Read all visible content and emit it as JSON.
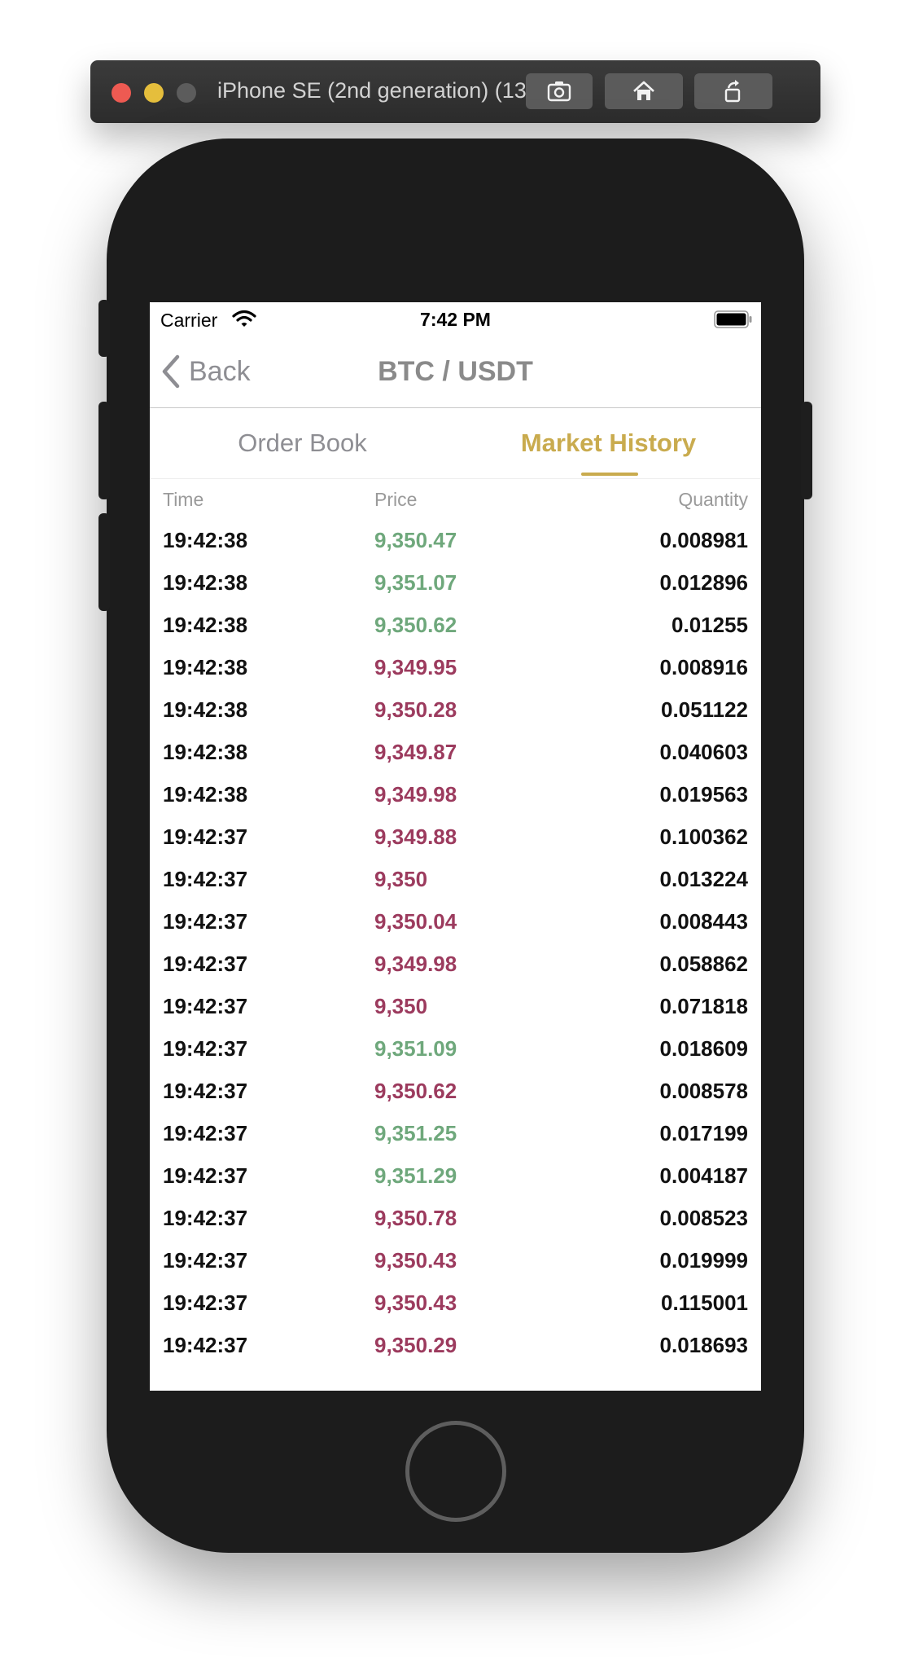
{
  "simulator": {
    "title": "iPhone SE (2nd generation) (13...",
    "buttons": [
      "screenshot",
      "home",
      "rotate"
    ]
  },
  "status_bar": {
    "carrier": "Carrier",
    "time": "7:42 PM"
  },
  "nav": {
    "back_label": "Back",
    "title": "BTC / USDT"
  },
  "tabs": [
    {
      "label": "Order Book",
      "selected": false
    },
    {
      "label": "Market History",
      "selected": true
    }
  ],
  "columns": {
    "time": "Time",
    "price": "Price",
    "quantity": "Quantity"
  },
  "colors": {
    "up": "#6fa87c",
    "down": "#9c3b5e",
    "accent": "#c9ab4e"
  },
  "trades": [
    {
      "time": "19:42:38",
      "price": "9,350.47",
      "side": "up",
      "quantity": "0.008981"
    },
    {
      "time": "19:42:38",
      "price": "9,351.07",
      "side": "up",
      "quantity": "0.012896"
    },
    {
      "time": "19:42:38",
      "price": "9,350.62",
      "side": "up",
      "quantity": "0.01255"
    },
    {
      "time": "19:42:38",
      "price": "9,349.95",
      "side": "down",
      "quantity": "0.008916"
    },
    {
      "time": "19:42:38",
      "price": "9,350.28",
      "side": "down",
      "quantity": "0.051122"
    },
    {
      "time": "19:42:38",
      "price": "9,349.87",
      "side": "down",
      "quantity": "0.040603"
    },
    {
      "time": "19:42:38",
      "price": "9,349.98",
      "side": "down",
      "quantity": "0.019563"
    },
    {
      "time": "19:42:37",
      "price": "9,349.88",
      "side": "down",
      "quantity": "0.100362"
    },
    {
      "time": "19:42:37",
      "price": "9,350",
      "side": "down",
      "quantity": "0.013224"
    },
    {
      "time": "19:42:37",
      "price": "9,350.04",
      "side": "down",
      "quantity": "0.008443"
    },
    {
      "time": "19:42:37",
      "price": "9,349.98",
      "side": "down",
      "quantity": "0.058862"
    },
    {
      "time": "19:42:37",
      "price": "9,350",
      "side": "down",
      "quantity": "0.071818"
    },
    {
      "time": "19:42:37",
      "price": "9,351.09",
      "side": "up",
      "quantity": "0.018609"
    },
    {
      "time": "19:42:37",
      "price": "9,350.62",
      "side": "down",
      "quantity": "0.008578"
    },
    {
      "time": "19:42:37",
      "price": "9,351.25",
      "side": "up",
      "quantity": "0.017199"
    },
    {
      "time": "19:42:37",
      "price": "9,351.29",
      "side": "up",
      "quantity": "0.004187"
    },
    {
      "time": "19:42:37",
      "price": "9,350.78",
      "side": "down",
      "quantity": "0.008523"
    },
    {
      "time": "19:42:37",
      "price": "9,350.43",
      "side": "down",
      "quantity": "0.019999"
    },
    {
      "time": "19:42:37",
      "price": "9,350.43",
      "side": "down",
      "quantity": "0.115001"
    },
    {
      "time": "19:42:37",
      "price": "9,350.29",
      "side": "down",
      "quantity": "0.018693"
    }
  ]
}
